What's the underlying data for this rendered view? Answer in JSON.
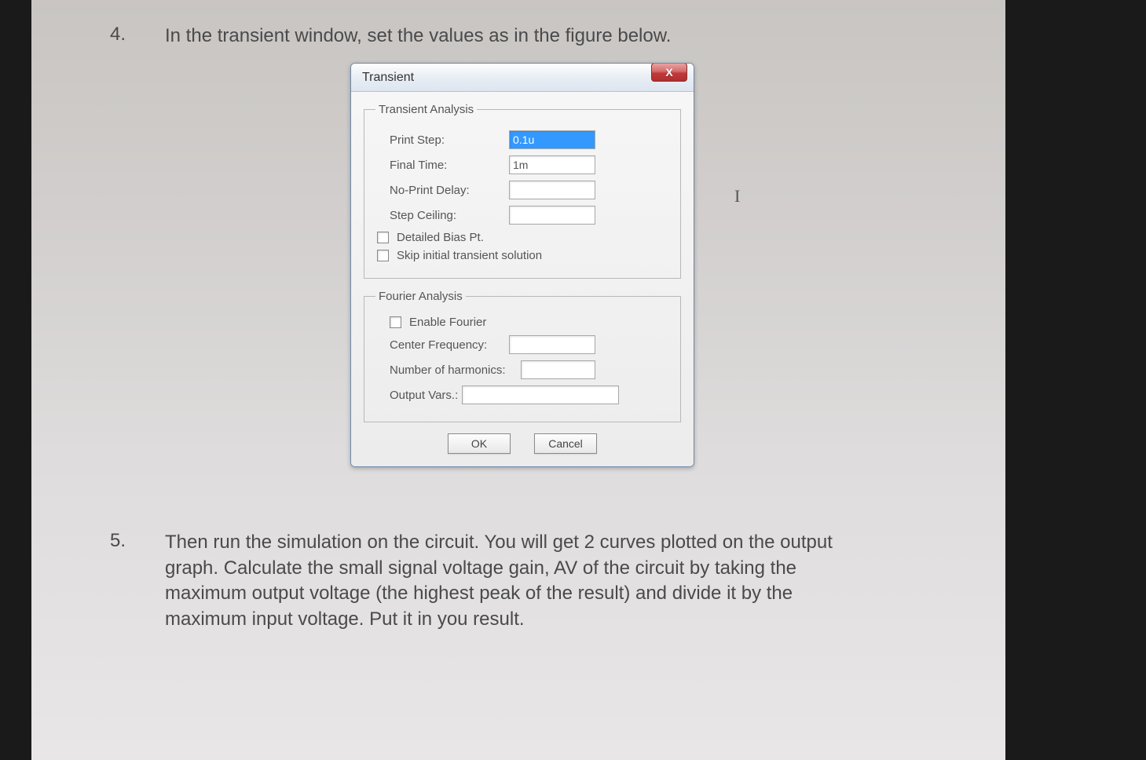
{
  "step4": {
    "number": "4.",
    "text": "In the transient window, set the values as in the figure below."
  },
  "dialog": {
    "title": "Transient",
    "close": "X",
    "transient_group": {
      "legend": "Transient Analysis",
      "print_step_label": "Print Step:",
      "print_step_value": "0.1u",
      "final_time_label": "Final Time:",
      "final_time_value": "1m",
      "no_print_delay_label": "No-Print Delay:",
      "no_print_delay_value": "",
      "step_ceiling_label": "Step Ceiling:",
      "step_ceiling_value": "",
      "detailed_bias_label": "Detailed Bias Pt.",
      "skip_initial_label": "Skip initial transient solution"
    },
    "fourier_group": {
      "legend": "Fourier Analysis",
      "enable_label": "Enable Fourier",
      "center_freq_label": "Center Frequency:",
      "center_freq_value": "",
      "harmonics_label": "Number of harmonics:",
      "harmonics_value": "",
      "output_vars_label": "Output Vars.:",
      "output_vars_value": ""
    },
    "ok": "OK",
    "cancel": "Cancel"
  },
  "step5": {
    "number": "5.",
    "text": "Then run the simulation on the circuit. You will get 2 curves plotted on the output graph. Calculate the small signal voltage gain, AV of the circuit by taking the maximum output voltage (the highest peak of the result) and divide it by the maximum input voltage. Put it in you result."
  }
}
